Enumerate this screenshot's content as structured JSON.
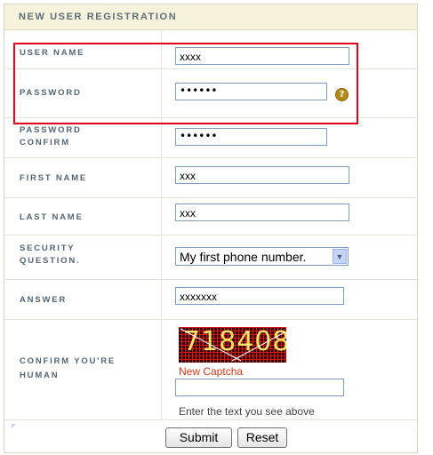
{
  "form": {
    "title": "NEW USER REGISTRATION",
    "fields": {
      "username": {
        "label": "USER NAME",
        "value": "xxxx"
      },
      "password": {
        "label": "PASSWORD",
        "value": "••••••"
      },
      "password_confirm": {
        "label_line1": "PASSWORD",
        "label_line2": "CONFIRM",
        "value": "••••••"
      },
      "first_name": {
        "label": "FIRST NAME",
        "value": "xxx"
      },
      "last_name": {
        "label": "LAST NAME",
        "value": "xxx"
      },
      "security_question": {
        "label_line1": "SECURITY",
        "label_line2": "QUESTION.",
        "selected": "My first phone number."
      },
      "answer": {
        "label": "ANSWER",
        "value": "xxxxxxx"
      },
      "captcha": {
        "label_line1": "CONFIRM YOU'RE",
        "label_line2": "HUMAN",
        "image_text": "718408",
        "new_captcha_link": "New Captcha",
        "input_value": "",
        "hint": "Enter the text you see above"
      }
    },
    "help_icon_glyph": "?",
    "buttons": {
      "submit": "Submit",
      "reset": "Reset"
    }
  },
  "colors": {
    "header_bg": "#f6f2dc",
    "label_text": "#566574",
    "highlight_box": "#e0001a",
    "new_captcha_link": "#cc3a1a"
  },
  "icons": {
    "help": "question-mark-circle-icon",
    "dropdown": "chevron-down-icon"
  }
}
